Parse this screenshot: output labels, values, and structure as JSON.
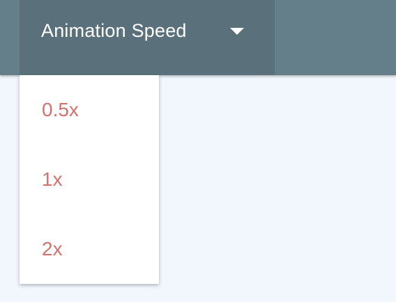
{
  "toolbar": {
    "dropdown_label": "Animation Speed",
    "caret_icon": "caret-down-icon"
  },
  "menu": {
    "items": [
      {
        "label": "0.5x"
      },
      {
        "label": "1x"
      },
      {
        "label": "2x"
      }
    ]
  },
  "colors": {
    "toolbar_bg": "#647e8a",
    "toggle_bg": "#5a717b",
    "page_bg": "#f1f7fd",
    "menu_text": "#d4716d",
    "toggle_text": "#ffffff"
  }
}
